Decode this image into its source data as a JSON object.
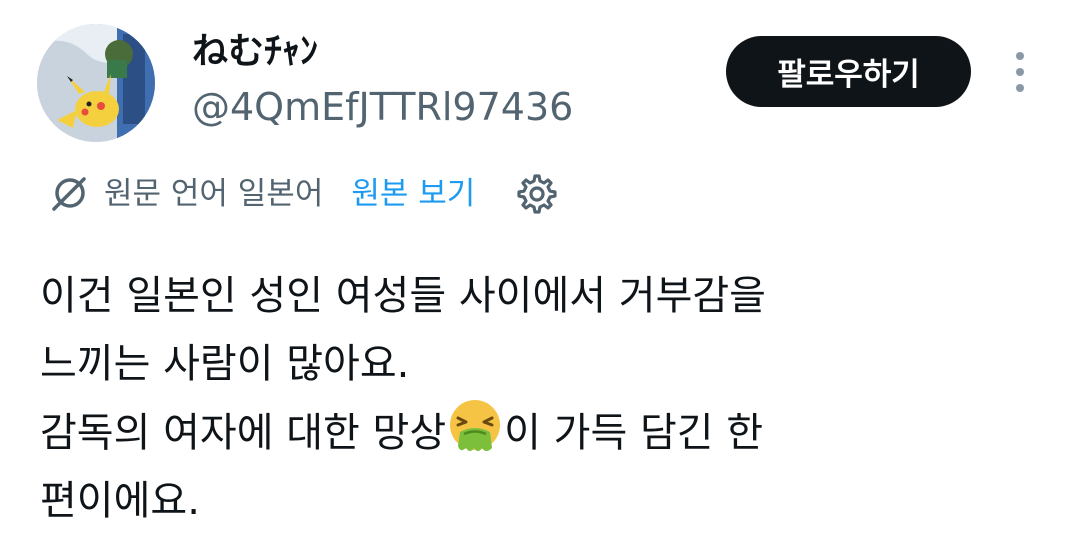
{
  "author": {
    "display_name": "ねむﾁｬﾝ",
    "handle": "@4QmEfJTTRl97436",
    "avatar_icon": "pikachu-avatar"
  },
  "actions": {
    "follow_label": "팔로우하기",
    "more_icon": "more-vertical-icon"
  },
  "translation": {
    "icon": "translate-icon",
    "language_note": "원문 언어 일본어",
    "view_original_label": "원본 보기",
    "settings_icon": "gear-icon"
  },
  "tweet": {
    "line1": "이건 일본인 성인 여성들 사이에서 거부감을",
    "line2": "느끼는 사람이 많아요.",
    "line3_before": "감독의 여자에 대한 망상",
    "emoji": "nauseated-face-emoji",
    "line3_after": "이 가득 담긴 한",
    "line4": "편이에요."
  },
  "colors": {
    "text": "#0f1419",
    "secondary": "#536471",
    "link": "#1d9bf0",
    "button_bg": "#0f1419"
  }
}
